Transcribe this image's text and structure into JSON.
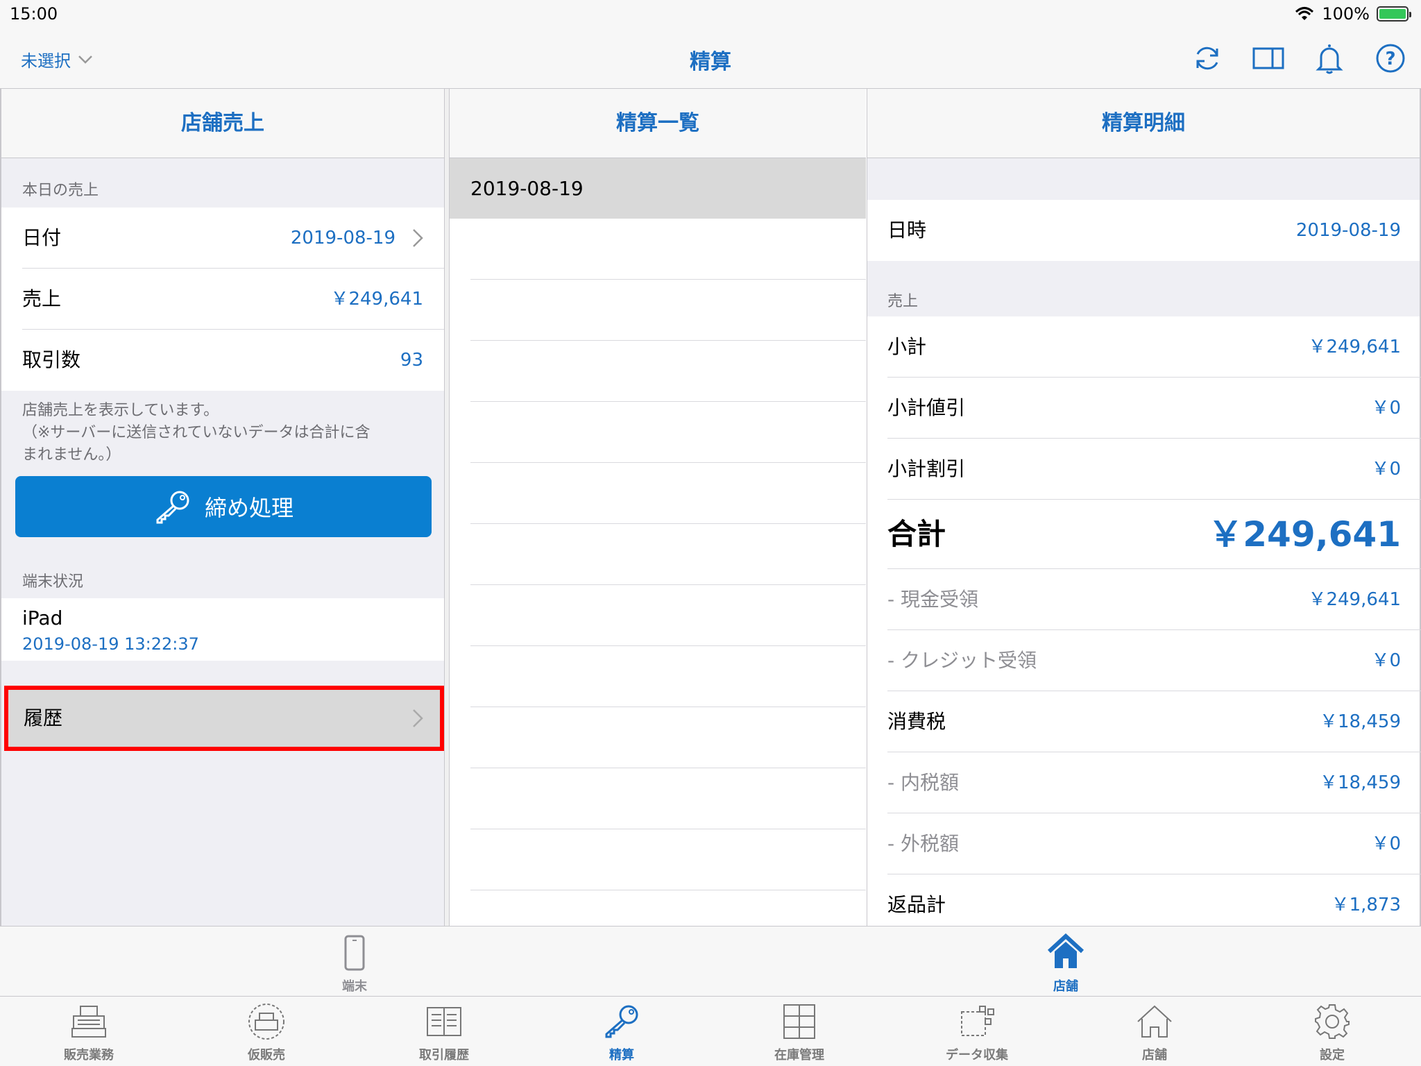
{
  "status": {
    "time": "15:00",
    "battery": "100%"
  },
  "nav": {
    "store_select": "未選択",
    "title": "精算"
  },
  "left": {
    "header": "店舗売上",
    "section_today": "本日の売上",
    "rows": [
      {
        "label": "日付",
        "value": "2019-08-19"
      },
      {
        "label": "売上",
        "value": "￥249,641"
      },
      {
        "label": "取引数",
        "value": "93"
      }
    ],
    "note_line1": "店舗売上を表示しています。",
    "note_line2": "（※サーバーに送信されていないデータは合計に含",
    "note_line3": "まれません。）",
    "close_button": "締め処理",
    "section_terminal": "端末状況",
    "terminal_name": "iPad",
    "terminal_time": "2019-08-19 13:22:37",
    "history": "履歴"
  },
  "middle": {
    "header": "精算一覧",
    "items": [
      "2019-08-19"
    ]
  },
  "right": {
    "header": "精算明細",
    "datetime_label": "日時",
    "datetime_value": "2019-08-19",
    "section_sales": "売上",
    "rows": [
      {
        "label": "小計",
        "value": "￥249,641"
      },
      {
        "label": "小計値引",
        "value": "￥0"
      },
      {
        "label": "小計割引",
        "value": "￥0"
      }
    ],
    "total_label": "合計",
    "total_value": "￥249,641",
    "rows2": [
      {
        "label": "- 現金受領",
        "value": "￥249,641"
      },
      {
        "label": "- クレジット受領",
        "value": "￥0"
      },
      {
        "label": "消費税",
        "value": "￥18,459"
      },
      {
        "label": "- 内税額",
        "value": "￥18,459"
      },
      {
        "label": "- 外税額",
        "value": "￥0"
      },
      {
        "label": "返品計",
        "value": "￥1,873"
      }
    ]
  },
  "segments": [
    {
      "label": "端末",
      "icon": "phone-icon",
      "active": false
    },
    {
      "label": "店舗",
      "icon": "home-icon",
      "active": true
    }
  ],
  "tabs": [
    {
      "label": "販売業務",
      "icon": "register-icon"
    },
    {
      "label": "仮販売",
      "icon": "temp-sale-icon"
    },
    {
      "label": "取引履歴",
      "icon": "book-icon"
    },
    {
      "label": "精算",
      "icon": "key-icon"
    },
    {
      "label": "在庫管理",
      "icon": "cabinet-icon"
    },
    {
      "label": "データ収集",
      "icon": "data-icon"
    },
    {
      "label": "店舗",
      "icon": "store-icon"
    },
    {
      "label": "設定",
      "icon": "gear-icon"
    }
  ],
  "colors": {
    "accent": "#1d6fc2",
    "button": "#0a7fd1",
    "highlight": "#ff0000"
  }
}
